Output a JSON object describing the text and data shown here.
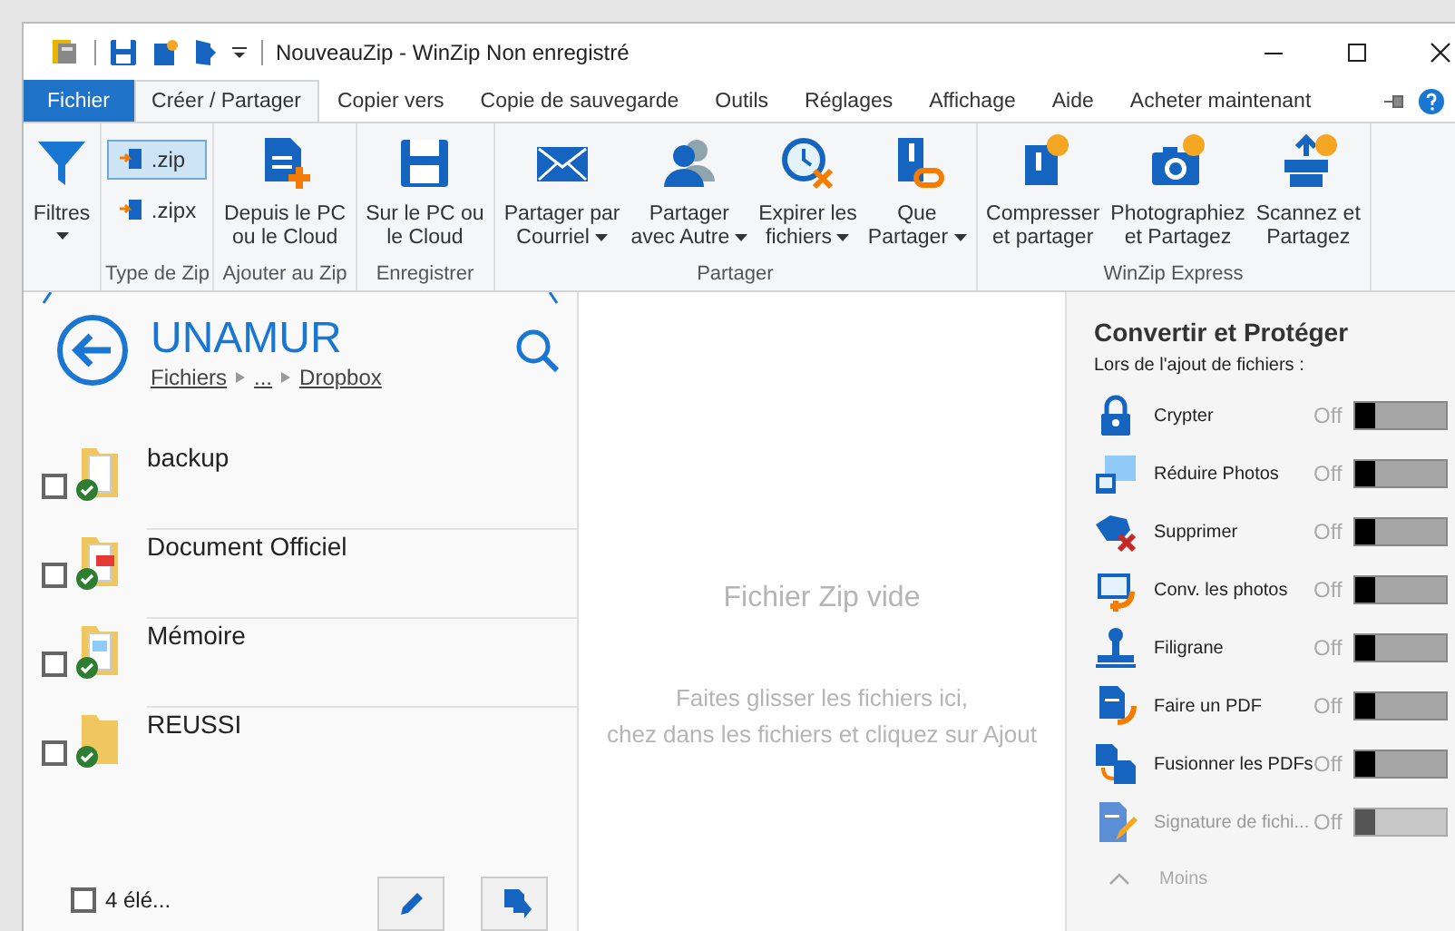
{
  "window": {
    "title": "NouveauZip - WinZip Non enregistré"
  },
  "tabs": [
    {
      "label": "Fichier",
      "kind": "file",
      "selected": false
    },
    {
      "label": "Créer / Partager",
      "kind": "tab",
      "selected": true
    },
    {
      "label": "Copier vers",
      "kind": "tab",
      "selected": false
    },
    {
      "label": "Copie de sauvegarde",
      "kind": "tab",
      "selected": false
    },
    {
      "label": "Outils",
      "kind": "tab",
      "selected": false
    },
    {
      "label": "Réglages",
      "kind": "tab",
      "selected": false
    },
    {
      "label": "Affichage",
      "kind": "tab",
      "selected": false
    },
    {
      "label": "Aide",
      "kind": "tab",
      "selected": false
    },
    {
      "label": "Acheter maintenant",
      "kind": "tab",
      "selected": false
    }
  ],
  "ribbon": {
    "groups": [
      {
        "buttons": [
          {
            "kind": "large",
            "lines": [
              "Filtres"
            ],
            "dropdown": true
          }
        ]
      },
      {
        "label": "Type de Zip",
        "buttons": [
          {
            "kind": "small",
            "lines": [
              ".zip"
            ],
            "selected": true
          },
          {
            "kind": "small",
            "lines": [
              ".zipx"
            ],
            "selected": false
          }
        ]
      },
      {
        "label": "Ajouter au Zip",
        "buttons": [
          {
            "kind": "large",
            "lines": [
              "Depuis le PC",
              "ou le Cloud"
            ],
            "dropdown": false
          }
        ]
      },
      {
        "label": "Enregistrer",
        "buttons": [
          {
            "kind": "large",
            "lines": [
              "Sur le PC ou",
              "le Cloud"
            ],
            "dropdown": false
          }
        ]
      },
      {
        "label": "Partager",
        "buttons": [
          {
            "kind": "large",
            "lines": [
              "Partager par",
              "Courriel"
            ],
            "dropdown": true
          },
          {
            "kind": "large",
            "lines": [
              "Partager",
              "avec Autre"
            ],
            "dropdown": true
          },
          {
            "kind": "large",
            "lines": [
              "Expirer les",
              "fichiers"
            ],
            "dropdown": true
          },
          {
            "kind": "large",
            "lines": [
              "Que",
              "Partager"
            ],
            "dropdown": true
          }
        ]
      },
      {
        "label": "WinZip Express",
        "buttons": [
          {
            "kind": "large",
            "lines": [
              "Compresser",
              "et partager"
            ],
            "dropdown": false
          },
          {
            "kind": "large",
            "lines": [
              "Photographiez",
              "et Partagez"
            ],
            "dropdown": false
          },
          {
            "kind": "large",
            "lines": [
              "Scannez et",
              "Partagez"
            ],
            "dropdown": false
          }
        ]
      }
    ]
  },
  "browser": {
    "title": "UNAMUR",
    "breadcrumb": [
      "Fichiers",
      "...",
      "Dropbox"
    ],
    "files": [
      {
        "name": "backup",
        "checked": false
      },
      {
        "name": "Document Officiel",
        "checked": false
      },
      {
        "name": "Mémoire",
        "checked": false
      },
      {
        "name": "REUSSI",
        "checked": false
      }
    ],
    "footer": {
      "count": "4 élé...",
      "checked": false
    }
  },
  "zip_area": {
    "title": "Fichier Zip vide",
    "lines": [
      "Faites glisser les fichiers ici,",
      "chez dans les fichiers et cliquez sur Ajout"
    ]
  },
  "convert": {
    "title": "Convertir et Protéger",
    "subtitle": "Lors de l'ajout de fichiers :",
    "options": [
      {
        "label": "Crypter",
        "state": "Off",
        "on": false,
        "disabled": false
      },
      {
        "label": "Réduire Photos",
        "state": "Off",
        "on": false,
        "disabled": false
      },
      {
        "label": "Supprimer",
        "state": "Off",
        "on": false,
        "disabled": false
      },
      {
        "label": "Conv. les photos",
        "state": "Off",
        "on": false,
        "disabled": false
      },
      {
        "label": "Filigrane",
        "state": "Off",
        "on": false,
        "disabled": false
      },
      {
        "label": "Faire un PDF",
        "state": "Off",
        "on": false,
        "disabled": false
      },
      {
        "label": "Fusionner les PDFs",
        "state": "Off",
        "on": false,
        "disabled": false
      },
      {
        "label": "Signature de fichi...",
        "state": "Off",
        "on": false,
        "disabled": true
      }
    ],
    "less": "Moins"
  }
}
